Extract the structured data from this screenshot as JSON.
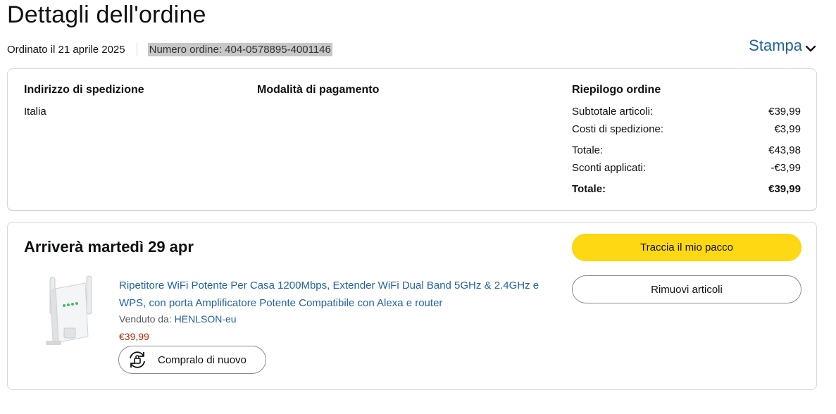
{
  "page": {
    "title": "Dettagli dell'ordine",
    "order_date": "Ordinato il 21 aprile 2025",
    "order_number": "Numero ordine: 404-0578895-4001146",
    "print_label": "Stampa"
  },
  "summary": {
    "shipping_title": "Indirizzo di spedizione",
    "shipping_country": "Italia",
    "payment_title": "Modalità di pagamento",
    "recap_title": "Riepilogo ordine",
    "rows": [
      {
        "label": "Subtotale articoli:",
        "value": "€39,99"
      },
      {
        "label": "Costi di spedizione:",
        "value": "€3,99"
      },
      {
        "label": "Totale:",
        "value": "€43,98"
      },
      {
        "label": "Sconti applicati:",
        "value": "-€3,99"
      },
      {
        "label": "Totale:",
        "value": "€39,99"
      }
    ]
  },
  "shipment": {
    "arrival": "Arriverà martedì 29 apr",
    "product_title": "Ripetitore WiFi Potente Per Casa 1200Mbps, Extender WiFi Dual Band 5GHz & 2.4GHz e WPS, con porta Amplificatore Potente Compatibile con Alexa e router",
    "sold_by_label": "Venduto da:",
    "seller": "HENLSON-eu",
    "price": "€39,99",
    "rebuy_label": "Compralo di nuovo",
    "track_label": "Traccia il mio pacco",
    "remove_label": "Rimuovi articoli"
  },
  "icons": {
    "print": "chevron-down-icon",
    "rebuy": "rebuy-icon",
    "product": "wifi-extender-image"
  },
  "colors": {
    "link": "#2162a1",
    "price": "#b12704",
    "track_button": "#ffd814"
  }
}
